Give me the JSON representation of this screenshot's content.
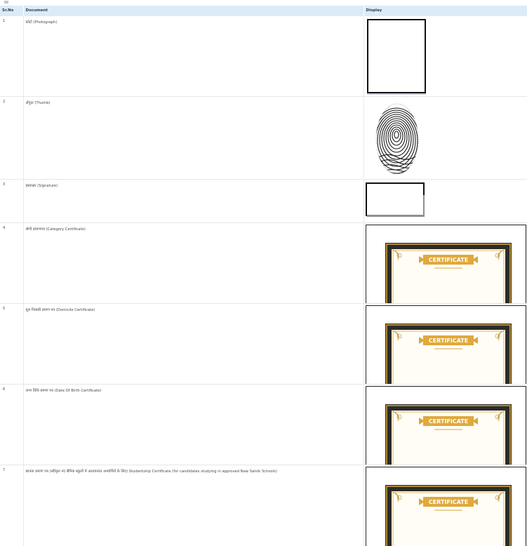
{
  "table": {
    "headers": {
      "sr_no": "Sr.No",
      "document": "Document",
      "display": "Display"
    },
    "rows": [
      {
        "no": "1",
        "document": "फ़ोटो (Photograph)",
        "display_type": "photograph-placeholder"
      },
      {
        "no": "2",
        "document": "अँगूठा (Thumb)",
        "display_type": "thumbprint"
      },
      {
        "no": "3",
        "document": "हस्ताक्षर (Signature)",
        "display_type": "signature-placeholder"
      },
      {
        "no": "4",
        "document": "श्रेणी प्रमाणपत्र (Category Certificate)",
        "display_type": "certificate"
      },
      {
        "no": "5",
        "document": "मूल निवासी प्रमाण पत्र (Domicile Certificate)",
        "display_type": "certificate"
      },
      {
        "no": "6",
        "document": "जन्म तिथि प्रमाण पत्र (Date Of Birth Certificate)",
        "display_type": "certificate"
      },
      {
        "no": "7",
        "document": "छात्रता प्रमाण पत्र (स्वीकृत नए सैनिक स्कूलों में अध्ययनरत अभ्यर्थियों के लिए) Studentship Certificate (for candidates studying in approved New Sainik Schools)",
        "display_type": "certificate"
      }
    ]
  },
  "certificate_label": "CERTIFICATE",
  "colors": {
    "header_bg": "#dcebf7",
    "border": "#e4e7eb",
    "cert_frame_dark": "#2b2b2b",
    "cert_gold": "#d9a73a"
  },
  "icons": {
    "thumb": "fingerprint-icon",
    "certificate": "certificate-image"
  }
}
